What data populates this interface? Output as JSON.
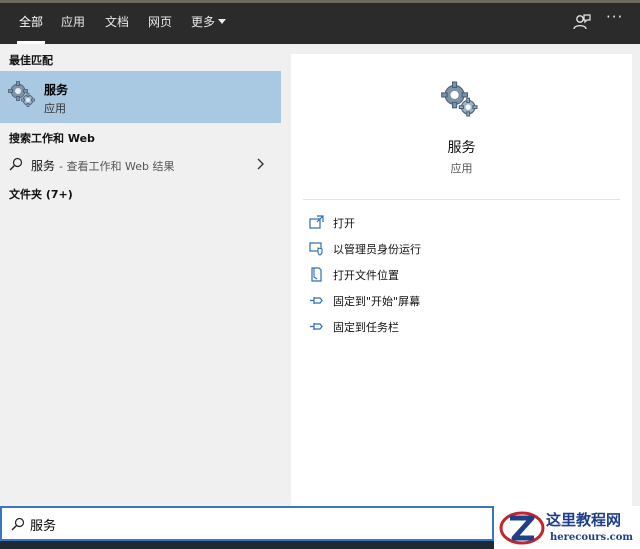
{
  "tabs": [
    {
      "label": "全部",
      "active": true
    },
    {
      "label": "应用"
    },
    {
      "label": "文档"
    },
    {
      "label": "网页"
    },
    {
      "label": "更多"
    }
  ],
  "top_icons": [
    "feedback-icon",
    "more-options-icon"
  ],
  "left": {
    "best_match_title": "最佳匹配",
    "best_match": {
      "name": "服务",
      "type": "应用",
      "icon": "gear-icon"
    },
    "web_title": "搜索工作和 Web",
    "web_result": {
      "query": "服务",
      "subtext": "- 查看工作和 Web 结果"
    },
    "folders_title": "文件夹 (7+)"
  },
  "preview": {
    "name": "服务",
    "type": "应用",
    "actions": [
      {
        "label": "打开",
        "icon": "open-icon"
      },
      {
        "label": "以管理员身份运行",
        "icon": "shield-icon"
      },
      {
        "label": "打开文件位置",
        "icon": "file-location-icon"
      },
      {
        "label": "固定到\"开始\"屏幕",
        "icon": "pin-icon"
      },
      {
        "label": "固定到任务栏",
        "icon": "pin-icon"
      }
    ]
  },
  "search": {
    "value": "服务"
  },
  "watermark": {
    "title": "这里教程网",
    "url": "herecours.com"
  },
  "colors": {
    "topbar": "#2b2b2b",
    "selected": "#a9c8e2",
    "accent": "#3a75c4"
  }
}
